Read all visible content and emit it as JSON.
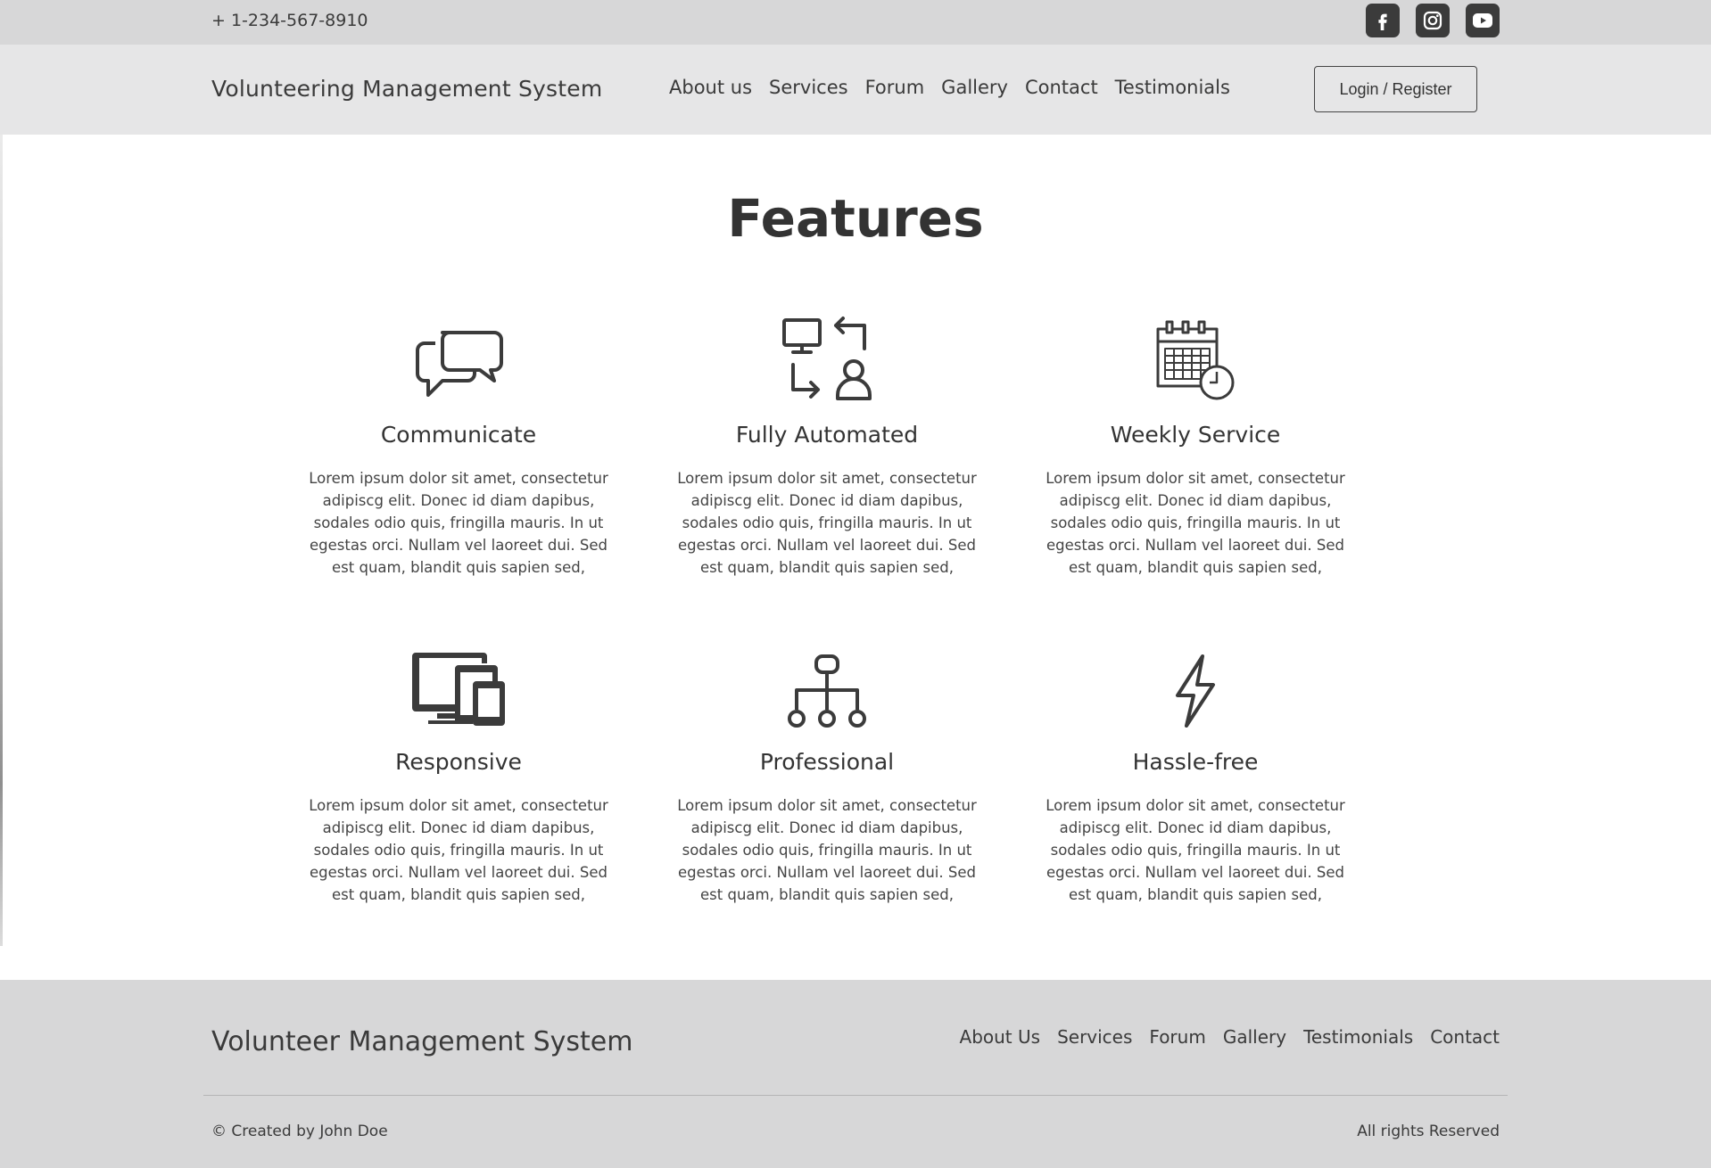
{
  "topbar": {
    "phone": "+ 1-234-567-8910",
    "social": [
      "facebook-icon",
      "instagram-icon",
      "youtube-icon"
    ]
  },
  "navbar": {
    "brand": "Volunteering Management System",
    "links": [
      "About us",
      "Services",
      "Forum",
      "Gallery",
      "Contact",
      "Testimonials"
    ],
    "login_label": "Login / Register"
  },
  "main": {
    "title": "Features",
    "features": [
      {
        "title": "Communicate",
        "icon": "chat-bubbles-icon",
        "text": "Lorem ipsum dolor sit amet, consectetur adipiscg elit. Donec id diam dapibus, sodales odio quis, fringilla mauris. In ut egestas orci. Nullam vel laoreet dui. Sed est quam, blandit quis sapien sed,"
      },
      {
        "title": "Fully Automated",
        "icon": "automation-icon",
        "text": "Lorem ipsum dolor sit amet, consectetur adipiscg elit. Donec id diam dapibus, sodales odio quis, fringilla mauris. In ut egestas orci. Nullam vel laoreet dui. Sed est quam, blandit quis sapien sed,"
      },
      {
        "title": "Weekly Service",
        "icon": "calendar-clock-icon",
        "text": "Lorem ipsum dolor sit amet, consectetur adipiscg elit. Donec id diam dapibus, sodales odio quis, fringilla mauris. In ut egestas orci. Nullam vel laoreet dui. Sed est quam, blandit quis sapien sed,"
      },
      {
        "title": "Responsive",
        "icon": "devices-icon",
        "text": "Lorem ipsum dolor sit amet, consectetur adipiscg elit. Donec id diam dapibus, sodales odio quis, fringilla mauris. In ut egestas orci. Nullam vel laoreet dui. Sed est quam, blandit quis sapien sed,"
      },
      {
        "title": "Professional",
        "icon": "hierarchy-icon",
        "text": "Lorem ipsum dolor sit amet, consectetur adipiscg elit. Donec id diam dapibus, sodales odio quis, fringilla mauris. In ut egestas orci. Nullam vel laoreet dui. Sed est quam, blandit quis sapien sed,"
      },
      {
        "title": "Hassle-free",
        "icon": "lightning-icon",
        "text": "Lorem ipsum dolor sit amet, consectetur adipiscg elit. Donec id diam dapibus, sodales odio quis, fringilla mauris. In ut egestas orci. Nullam vel laoreet dui. Sed est quam, blandit quis sapien sed,"
      }
    ]
  },
  "footer": {
    "brand": "Volunteer Management System",
    "links": [
      "About Us",
      "Services",
      "Forum",
      "Gallery",
      "Testimonials",
      "Contact"
    ],
    "copyright": "© Created by John Doe",
    "rights": "All rights Reserved"
  },
  "colors": {
    "topbar_bg": "#d7d7d8",
    "navbar_bg": "#e6e6e7",
    "footer_bg": "#d7d7d8",
    "icon": "#3b3b3b"
  }
}
